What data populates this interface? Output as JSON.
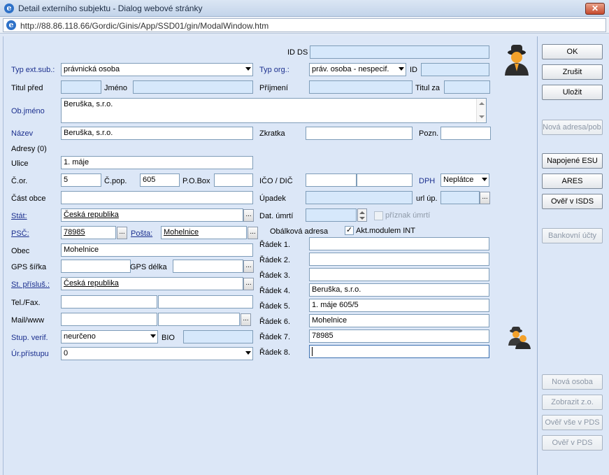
{
  "window": {
    "title": "Detail externího subjektu - Dialog webové stránky",
    "close_symbol": "✕",
    "url": "http://88.86.118.66/Gordic/Ginis/App/SSD01/gin/ModalWindow.htm",
    "ie_icon": "e"
  },
  "form": {
    "id_ds_label": "ID DS",
    "id_ds_value": "",
    "typ_ext_sub_label": "Typ ext.sub.:",
    "typ_ext_sub_value": "právnická osoba",
    "typ_org_label": "Typ org.:",
    "typ_org_value": "práv. osoba - nespecif.",
    "id_label": "ID",
    "id_value": "",
    "titul_pred_label": "Titul před",
    "titul_pred_value": "",
    "jmeno_label": "Jméno",
    "jmeno_value": "",
    "prijmeni_label": "Příjmení",
    "prijmeni_value": "",
    "titul_za_label": "Titul za",
    "titul_za_value": "",
    "objmeno_label": "Ob.jméno",
    "objmeno_value": "Beruška, s.r.o.",
    "nazev_label": "Název",
    "nazev_value": "Beruška, s.r.o.",
    "zkratka_label": "Zkratka",
    "zkratka_value": "",
    "pozn_label": "Pozn.",
    "pozn_value": "",
    "adresy_label": "Adresy (0)",
    "ulice_label": "Ulice",
    "ulice_value": "1. máje",
    "cor_label": "Č.or.",
    "cor_value": "5",
    "cpop_label": "Č.pop.",
    "cpop_value": "605",
    "pobox_label": "P.O.Box",
    "pobox_value": "",
    "ico_dic_label": "IČO / DIČ",
    "ico_value": "",
    "dic_value": "",
    "dph_label": "DPH",
    "dph_value": "Neplátce",
    "cast_obce_label": "Část obce",
    "cast_obce_value": "",
    "upadek_label": "Úpadek",
    "upadek_value": "",
    "url_up_label": "url úp.",
    "url_up_value": "",
    "stat_label": "Stát:",
    "stat_value": "Česká republika",
    "dat_umrti_label": "Dat. úmrtí",
    "dat_umrti_value": "",
    "priznak_umrti_label": "příznak úmrtí",
    "psc_label": "PSČ:",
    "psc_value": "78985",
    "posta_label": "Pošta:",
    "posta_value": "Mohelnice",
    "obalkova_label": "Obálková adresa",
    "akt_modulem_label": "Akt.modulem INT",
    "akt_modulem_checked": "✓",
    "obec_label": "Obec",
    "obec_value": "Mohelnice",
    "gps_sirka_label": "GPS šířka",
    "gps_sirka_value": "",
    "gps_delka_label": "GPS délka",
    "gps_delka_value": "",
    "st_prislus_label": "St. přísluš.:",
    "st_prislus_value": "Česká republika",
    "telfax_label": "Tel./Fax.",
    "tel_value": "",
    "fax_value": "",
    "mailwww_label": "Mail/www",
    "mail_value": "",
    "www_value": "",
    "stup_verif_label": "Stup. verif.",
    "stup_verif_value": "neurčeno",
    "bio_label": "BIO",
    "bio_value": "",
    "ur_pristupu_label": "Úr.přístupu",
    "ur_pristupu_value": "0",
    "dots": "...",
    "radek": [
      {
        "label": "Řádek 1.",
        "value": ""
      },
      {
        "label": "Řádek 2.",
        "value": ""
      },
      {
        "label": "Řádek 3.",
        "value": ""
      },
      {
        "label": "Řádek 4.",
        "value": "Beruška, s.r.o."
      },
      {
        "label": "Řádek 5.",
        "value": "1. máje 605/5"
      },
      {
        "label": "Řádek 6.",
        "value": "Mohelnice"
      },
      {
        "label": "Řádek 7.",
        "value": "78985"
      },
      {
        "label": "Řádek 8.",
        "value": ""
      }
    ]
  },
  "buttons": {
    "ok": "OK",
    "zrusit": "Zrušit",
    "ulozit": "Uložit",
    "nova_adresa": "Nová adresa/pob.",
    "napojene_esu": "Napojené ESU",
    "ares": "ARES",
    "over_isds": "Ověř v ISDS",
    "bankovni_ucty": "Bankovní účty",
    "nova_osoba": "Nová osoba",
    "zobrazit_zo": "Zobrazit z.o.",
    "over_vse_pds": "Ověř vše v PDS",
    "over_pds": "Ověř v PDS"
  },
  "icons": {
    "person": "person-icon",
    "persons": "persons-group-icon",
    "colors": {
      "accent_blue": "#1b2f8e",
      "panel": "#dce7f7",
      "readonly_field": "#d6e8fb"
    }
  }
}
